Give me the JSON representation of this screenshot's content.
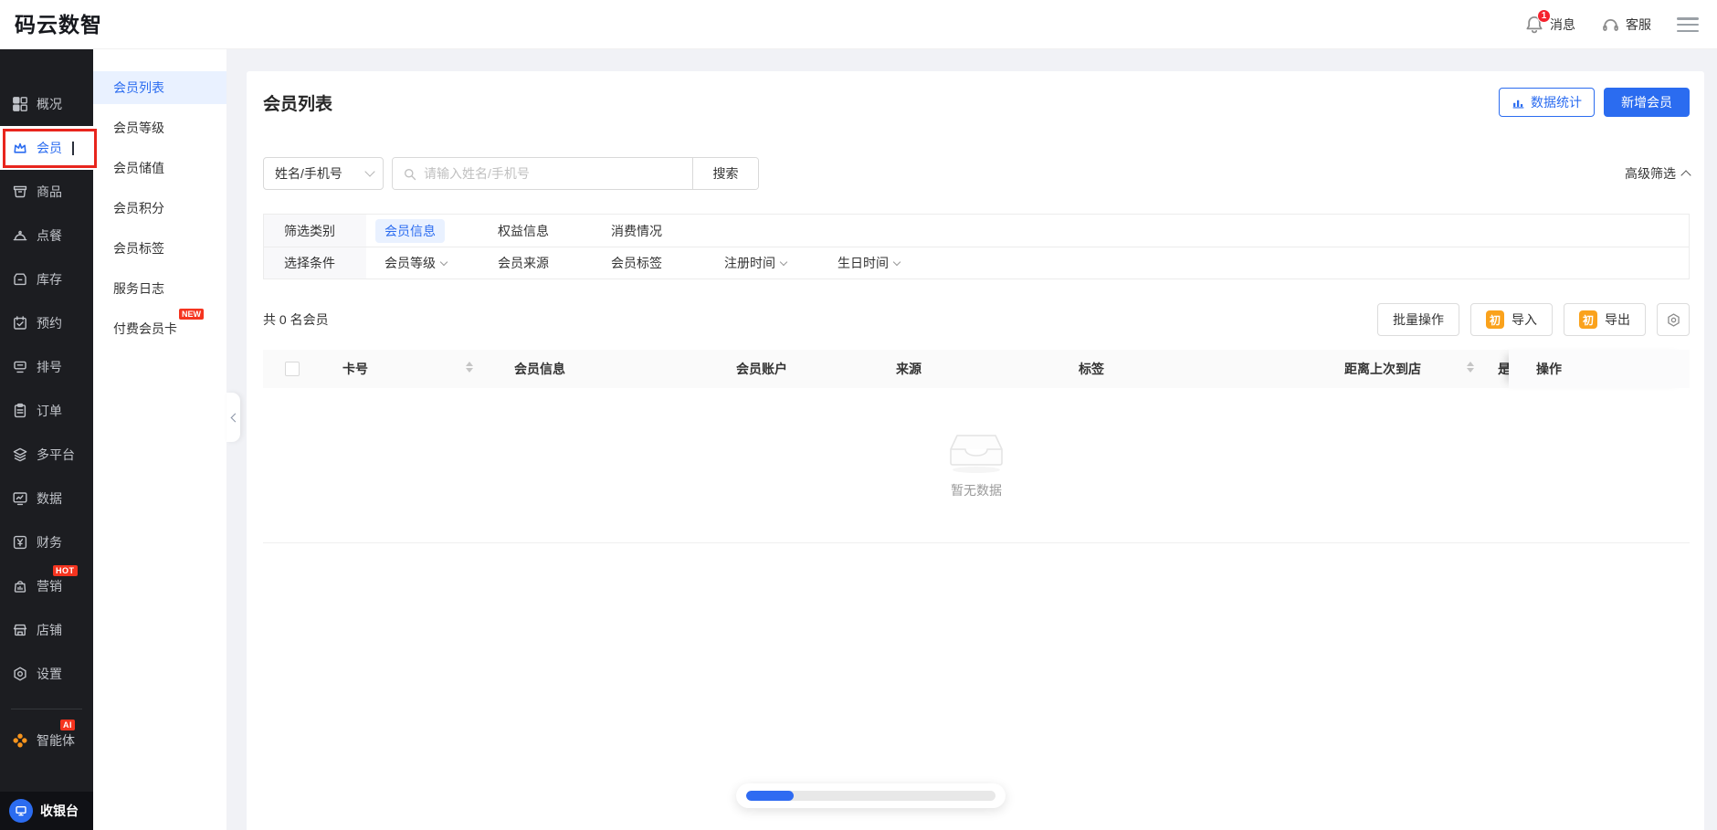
{
  "app": {
    "name": "码云数智"
  },
  "topbar": {
    "messages_label": "消息",
    "messages_badge": "1",
    "support_label": "客服"
  },
  "sidebar": {
    "items": [
      {
        "label": "概况",
        "icon": "grid-icon"
      },
      {
        "label": "会员",
        "icon": "crown-icon",
        "active": true
      },
      {
        "label": "商品",
        "icon": "goods-box-icon"
      },
      {
        "label": "点餐",
        "icon": "cloche-icon"
      },
      {
        "label": "库存",
        "icon": "inventory-icon"
      },
      {
        "label": "预约",
        "icon": "calendar-check-icon"
      },
      {
        "label": "排号",
        "icon": "ticket-machine-icon"
      },
      {
        "label": "订单",
        "icon": "clipboard-icon"
      },
      {
        "label": "多平台",
        "icon": "layers-icon"
      },
      {
        "label": "数据",
        "icon": "monitor-chart-icon"
      },
      {
        "label": "财务",
        "icon": "yuan-icon"
      },
      {
        "label": "营销",
        "icon": "shop-bag-icon",
        "badge": "HOT"
      },
      {
        "label": "店铺",
        "icon": "storefront-icon"
      },
      {
        "label": "设置",
        "icon": "gear-icon"
      },
      {
        "label": "智能体",
        "icon": "clover-icon",
        "badge": "AI"
      }
    ],
    "cashier_label": "收银台"
  },
  "submenu": {
    "items": [
      {
        "label": "会员列表",
        "active": true
      },
      {
        "label": "会员等级"
      },
      {
        "label": "会员储值"
      },
      {
        "label": "会员积分"
      },
      {
        "label": "会员标签"
      },
      {
        "label": "服务日志"
      },
      {
        "label": "付费会员卡",
        "badge": "NEW"
      }
    ]
  },
  "page": {
    "title": "会员列表",
    "stats_button": "数据统计",
    "add_button": "新增会员",
    "search": {
      "field": "姓名/手机号",
      "placeholder": "请输入姓名/手机号",
      "button": "搜索",
      "advanced": "高级筛选"
    },
    "filter": {
      "category_label": "筛选类别",
      "categories": [
        {
          "label": "会员信息",
          "active": true
        },
        {
          "label": "权益信息"
        },
        {
          "label": "消费情况"
        }
      ],
      "condition_label": "选择条件",
      "conditions": [
        {
          "label": "会员等级",
          "dropdown": true
        },
        {
          "label": "会员来源"
        },
        {
          "label": "会员标签"
        },
        {
          "label": "注册时间",
          "dropdown": true
        },
        {
          "label": "生日时间",
          "dropdown": true
        }
      ]
    },
    "toolbar": {
      "count": "共 0 名会员",
      "batch": "批量操作",
      "import": "导入",
      "export": "导出",
      "office_icon_text": "初"
    },
    "table": {
      "columns": [
        "卡号",
        "会员信息",
        "会员账户",
        "来源",
        "标签",
        "距离上次到店",
        "是",
        "操作"
      ],
      "empty_text": "暂无数据"
    },
    "loader": {
      "percent": 19
    }
  },
  "colors": {
    "accent": "#2b6cf0",
    "badge_red": "#f5341f",
    "office_orange": "#faa21c",
    "annotation_red": "#e8251d",
    "sidebar_bg": "#1c1d21",
    "progress_blue": "#2f6bf2"
  }
}
